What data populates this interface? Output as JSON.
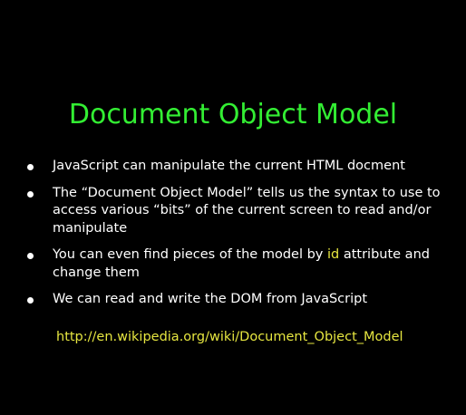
{
  "slide": {
    "title": "Document Object Model",
    "bullets": [
      {
        "text": "JavaScript can manipulate the current HTML docment"
      },
      {
        "text": "The “Document Object Model” tells us the syntax to use to access various “bits” of the current screen to read and/or manipulate"
      },
      {
        "before": "You can even find pieces of the model by ",
        "highlight": "id",
        "after": " attribute and change them"
      },
      {
        "text": "We can read and write the DOM from JavaScript"
      }
    ],
    "link": "http://en.wikipedia.org/wiki/Document_Object_Model"
  },
  "colors": {
    "background": "#000000",
    "title": "#33ee33",
    "body_text": "#ffffff",
    "highlight": "#e6e640"
  }
}
